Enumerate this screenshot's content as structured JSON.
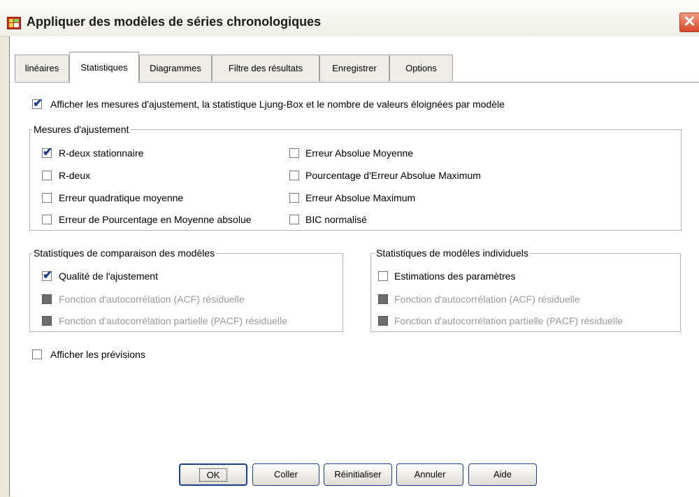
{
  "window": {
    "title": "Appliquer des modèles de séries chronologiques",
    "close_glyph": "✕"
  },
  "tabs": [
    {
      "label": "linéaires",
      "active": false
    },
    {
      "label": "Statistiques",
      "active": true
    },
    {
      "label": "Diagrammes",
      "active": false
    },
    {
      "label": "Filtre des résultats",
      "active": false
    },
    {
      "label": "Enregistrer",
      "active": false
    },
    {
      "label": "Options",
      "active": false
    }
  ],
  "main_option": {
    "label": "Afficher les mesures d'ajustement, la statistique Ljung-Box et le nombre de valeurs éloignées par modèle",
    "checked": true
  },
  "fit_measures": {
    "legend": "Mesures d'ajustement",
    "items": [
      {
        "label": "R-deux stationnaire",
        "checked": true
      },
      {
        "label": "R-deux",
        "checked": false
      },
      {
        "label": "Erreur quadratique moyenne",
        "checked": false
      },
      {
        "label": "Erreur de Pourcentage en Moyenne absolue",
        "checked": false
      },
      {
        "label": "Erreur Absolue Moyenne",
        "checked": false
      },
      {
        "label": "Pourcentage d'Erreur Absolue Maximum",
        "checked": false
      },
      {
        "label": "Erreur Absolue Maximum",
        "checked": false
      },
      {
        "label": "BIC normalisé",
        "checked": false
      }
    ]
  },
  "compare_models": {
    "legend": "Statistiques de comparaison des modèles",
    "items": [
      {
        "label": "Qualité de l'ajustement",
        "checked": true,
        "enabled": true
      },
      {
        "label": "Fonction d'autocorrélation (ACF) résiduelle",
        "checked": false,
        "enabled": false
      },
      {
        "label": "Fonction d'autocorrélation partielle (PACF) résiduelle",
        "checked": false,
        "enabled": false
      }
    ]
  },
  "individual_models": {
    "legend": "Statistiques de modèles individuels",
    "items": [
      {
        "label": "Estimations des paramètres",
        "checked": false,
        "enabled": true
      },
      {
        "label": "Fonction d'autocorrélation (ACF) résiduelle",
        "checked": false,
        "enabled": false
      },
      {
        "label": "Fonction d'autocorrélation partielle (PACF) résiduelle",
        "checked": false,
        "enabled": false
      }
    ]
  },
  "forecast_option": {
    "label": "Afficher les prévisions",
    "checked": false
  },
  "buttons": {
    "ok": "OK",
    "paste": "Coller",
    "reset": "Réinitialiser",
    "cancel": "Annuler",
    "help": "Aide"
  },
  "colors": {
    "accent": "#1a3f8f",
    "check": "#1f3b8c",
    "disabled_box": "#6e6e6e",
    "close": "#d5492b"
  }
}
